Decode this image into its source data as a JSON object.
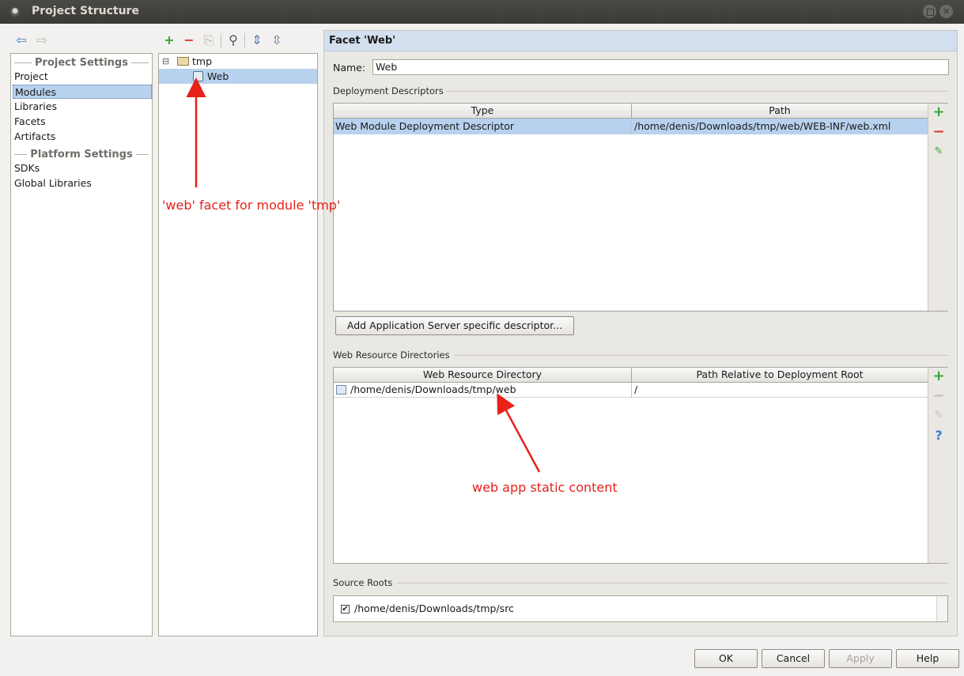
{
  "window": {
    "title": "Project Structure",
    "close_glyph": "✕"
  },
  "nav": {
    "back_icon": "arrow-left-icon",
    "forward_icon": "arrow-right-icon",
    "project_settings_header": "Project Settings",
    "platform_settings_header": "Platform Settings",
    "project_items": [
      "Project",
      "Modules",
      "Libraries",
      "Facets",
      "Artifacts"
    ],
    "platform_items": [
      "SDKs",
      "Global Libraries"
    ],
    "selected": "Modules"
  },
  "tree": {
    "toolbar": [
      "add-icon",
      "remove-icon",
      "copy-icon",
      "search-icon",
      "expand-all-icon",
      "collapse-all-icon"
    ],
    "toolbar_glyphs": {
      "add": "+",
      "remove": "−",
      "copy": "⎘",
      "search": "⚲",
      "expand": "⇕",
      "collapse": "⇳"
    },
    "expander": "⊟",
    "module": "tmp",
    "facet": "Web",
    "selected": "Web"
  },
  "facet": {
    "header": "Facet 'Web'",
    "name_label": "Name:",
    "name_value": "Web",
    "deployment": {
      "title": "Deployment Descriptors",
      "columns": [
        "Type",
        "Path"
      ],
      "rows": [
        {
          "type": "Web Module Deployment Descriptor",
          "path": "/home/denis/Downloads/tmp/web/WEB-INF/web.xml"
        }
      ],
      "add_descriptor_button": "Add Application Server specific descriptor..."
    },
    "web_resources": {
      "title": "Web Resource Directories",
      "columns": [
        "Web Resource Directory",
        "Path Relative to Deployment Root"
      ],
      "rows": [
        {
          "directory": "/home/denis/Downloads/tmp/web",
          "relative": "/"
        }
      ]
    },
    "source_roots": {
      "title": "Source Roots",
      "items": [
        {
          "checked": true,
          "path": "/home/denis/Downloads/tmp/src"
        }
      ]
    },
    "side_glyphs": {
      "add": "+",
      "remove": "−",
      "edit": "✎",
      "help": "?"
    }
  },
  "annotations": {
    "facet_note": "'web' facet for module 'tmp'",
    "static_note": "web app static content",
    "color": "#e8211a"
  },
  "footer": {
    "ok": "OK",
    "cancel": "Cancel",
    "apply": "Apply",
    "help": "Help"
  },
  "colors": {
    "selection": "#b8d1ee",
    "header_bar": "#d3dfee",
    "add_green": "#3aa23a",
    "remove_red": "#d33a2c"
  }
}
